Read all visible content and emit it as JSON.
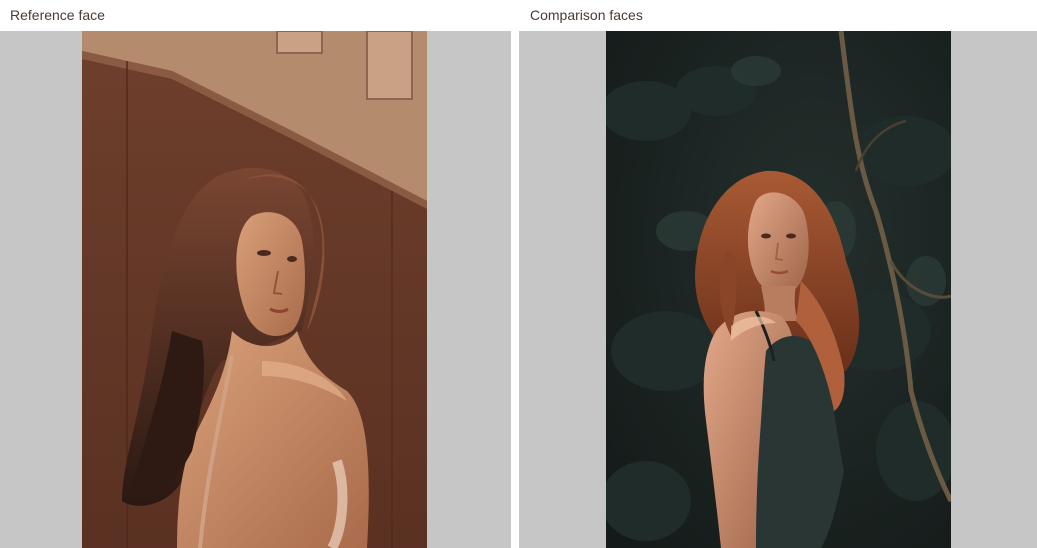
{
  "reference_panel": {
    "title": "Reference face",
    "photo_icon": "reference-photo-woman-sepia"
  },
  "comparison_panel": {
    "title": "Comparison faces",
    "photo_icon": "comparison-photo-woman-forest"
  },
  "colors": {
    "panel_background": "#c6c6c6",
    "header_text": "#4a3a33",
    "reference_tone": "#7a4a35",
    "comparison_tone": "#1c2422"
  }
}
